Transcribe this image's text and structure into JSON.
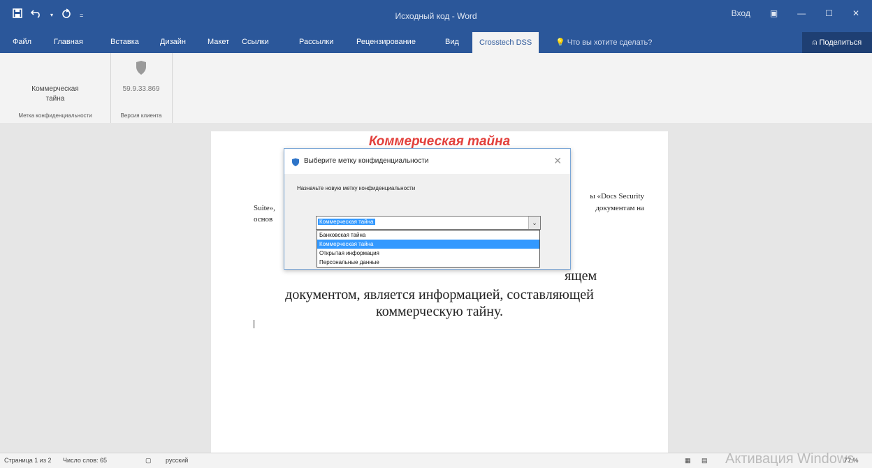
{
  "window": {
    "title": "Исходный код - Word",
    "signin": "Вход",
    "share": "Поделиться"
  },
  "tabs": [
    {
      "label": "Файл"
    },
    {
      "label": "Главная"
    },
    {
      "label": "Вставка"
    },
    {
      "label": "Дизайн"
    },
    {
      "label": "Макет"
    },
    {
      "label": "Ссылки"
    },
    {
      "label": "Рассылки"
    },
    {
      "label": "Рецензирование"
    },
    {
      "label": "Вид"
    },
    {
      "label": "Crosstech DSS"
    }
  ],
  "tell_me": "Что вы хотите сделать?",
  "ribbon": {
    "label_value_line1": "Коммерческая",
    "label_value_line2": "тайна",
    "label_group": "Метка конфиденциальности",
    "version_value": "59.9.33.869",
    "version_group": "Версия клиента"
  },
  "document": {
    "stamp": "Коммерческая тайна",
    "para_right_1": "ы «Docs Security",
    "para_right_2": "документам на",
    "para_left_1": "Suite»,",
    "para_left_2": "основ",
    "big_line1_tail": "ящем",
    "big_line2": "документом, является информацией, составляющей",
    "big_line3": "коммерческую тайну."
  },
  "dialog": {
    "title": "Выберите метку конфиденциальности",
    "prompt": "Назначьте новую метку конфиденциальности",
    "selected": "Коммерческая тайна",
    "options": [
      "Банковская тайна",
      "Коммерческая тайна",
      "Открытая информация",
      "Персональные данные"
    ]
  },
  "status": {
    "page": "Страница 1 из 2",
    "words": "Число слов: 65",
    "language": "русский",
    "zoom": "77 %",
    "watermark": "Активация Windows"
  },
  "colors": {
    "accent": "#2b579a",
    "stamp": "#e2403c",
    "highlight": "#3399ff"
  }
}
